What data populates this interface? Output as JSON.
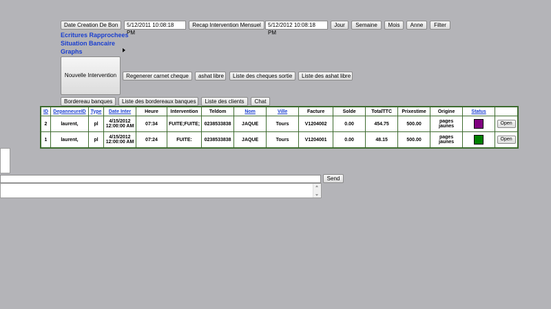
{
  "toolbar": {
    "date_creation_label": "Date Creation De Bon",
    "date_from": "5/12/2011 10:08:18 PM",
    "recap_label": "Recap Intervention Mensuel",
    "date_to": "5/12/2012 10:08:18 PM",
    "jour": "Jour",
    "semaine": "Semaine",
    "mois": "Mois",
    "anne": "Anne",
    "filter": "Filter"
  },
  "nav": {
    "ecritures": "Ecritures Rapprochees",
    "situation": "Situation Bancaire",
    "graphs": "Graphs"
  },
  "actions": {
    "nouvelle": "Nouvelle Intervention",
    "regenerer": "Regenerer carnet cheque",
    "ashat_libre": "ashat libre",
    "liste_cheques": "Liste des cheques sortie",
    "liste_ashat": "Liste des ashat libre",
    "bordereau": "Bordereau banques",
    "liste_bordereaux": "Liste des bordereaux banques",
    "liste_clients": "Liste des clients",
    "chat": "Chat"
  },
  "table": {
    "headers": [
      "ID",
      "DepanneureID",
      "Type",
      "Date Inter",
      "Heure",
      "Intervention",
      "Teldom",
      "Nom",
      "Ville",
      "Facture",
      "Solde",
      "TotalTTC",
      "Prixestime",
      "Origine",
      "Status",
      ""
    ],
    "rows": [
      {
        "id": "2",
        "depanneur": "laurent,",
        "type": "pl",
        "date": "4/15/2012 12:00:00 AM",
        "heure": "07:34",
        "intervention": "FUITE;FUITE;",
        "teldom": "0238533838",
        "nom": "JAQUE",
        "ville": "Tours",
        "facture": "V1204002",
        "solde": "0.00",
        "total": "454.75",
        "prix": "500.00",
        "origine": "pages jaunes",
        "status_color": "#800080",
        "open": "Open"
      },
      {
        "id": "1",
        "depanneur": "laurent,",
        "type": "pl",
        "date": "4/15/2012 12:00:00 AM",
        "heure": "07:24",
        "intervention": "FUITE:",
        "teldom": "0238533838",
        "nom": "JAQUE",
        "ville": "Tours",
        "facture": "V1204001",
        "solde": "0.00",
        "total": "48.15",
        "prix": "500.00",
        "origine": "pages jaunes",
        "status_color": "#008000",
        "open": "Open"
      }
    ]
  },
  "chat": {
    "send_label": "Send",
    "message_value": ""
  }
}
